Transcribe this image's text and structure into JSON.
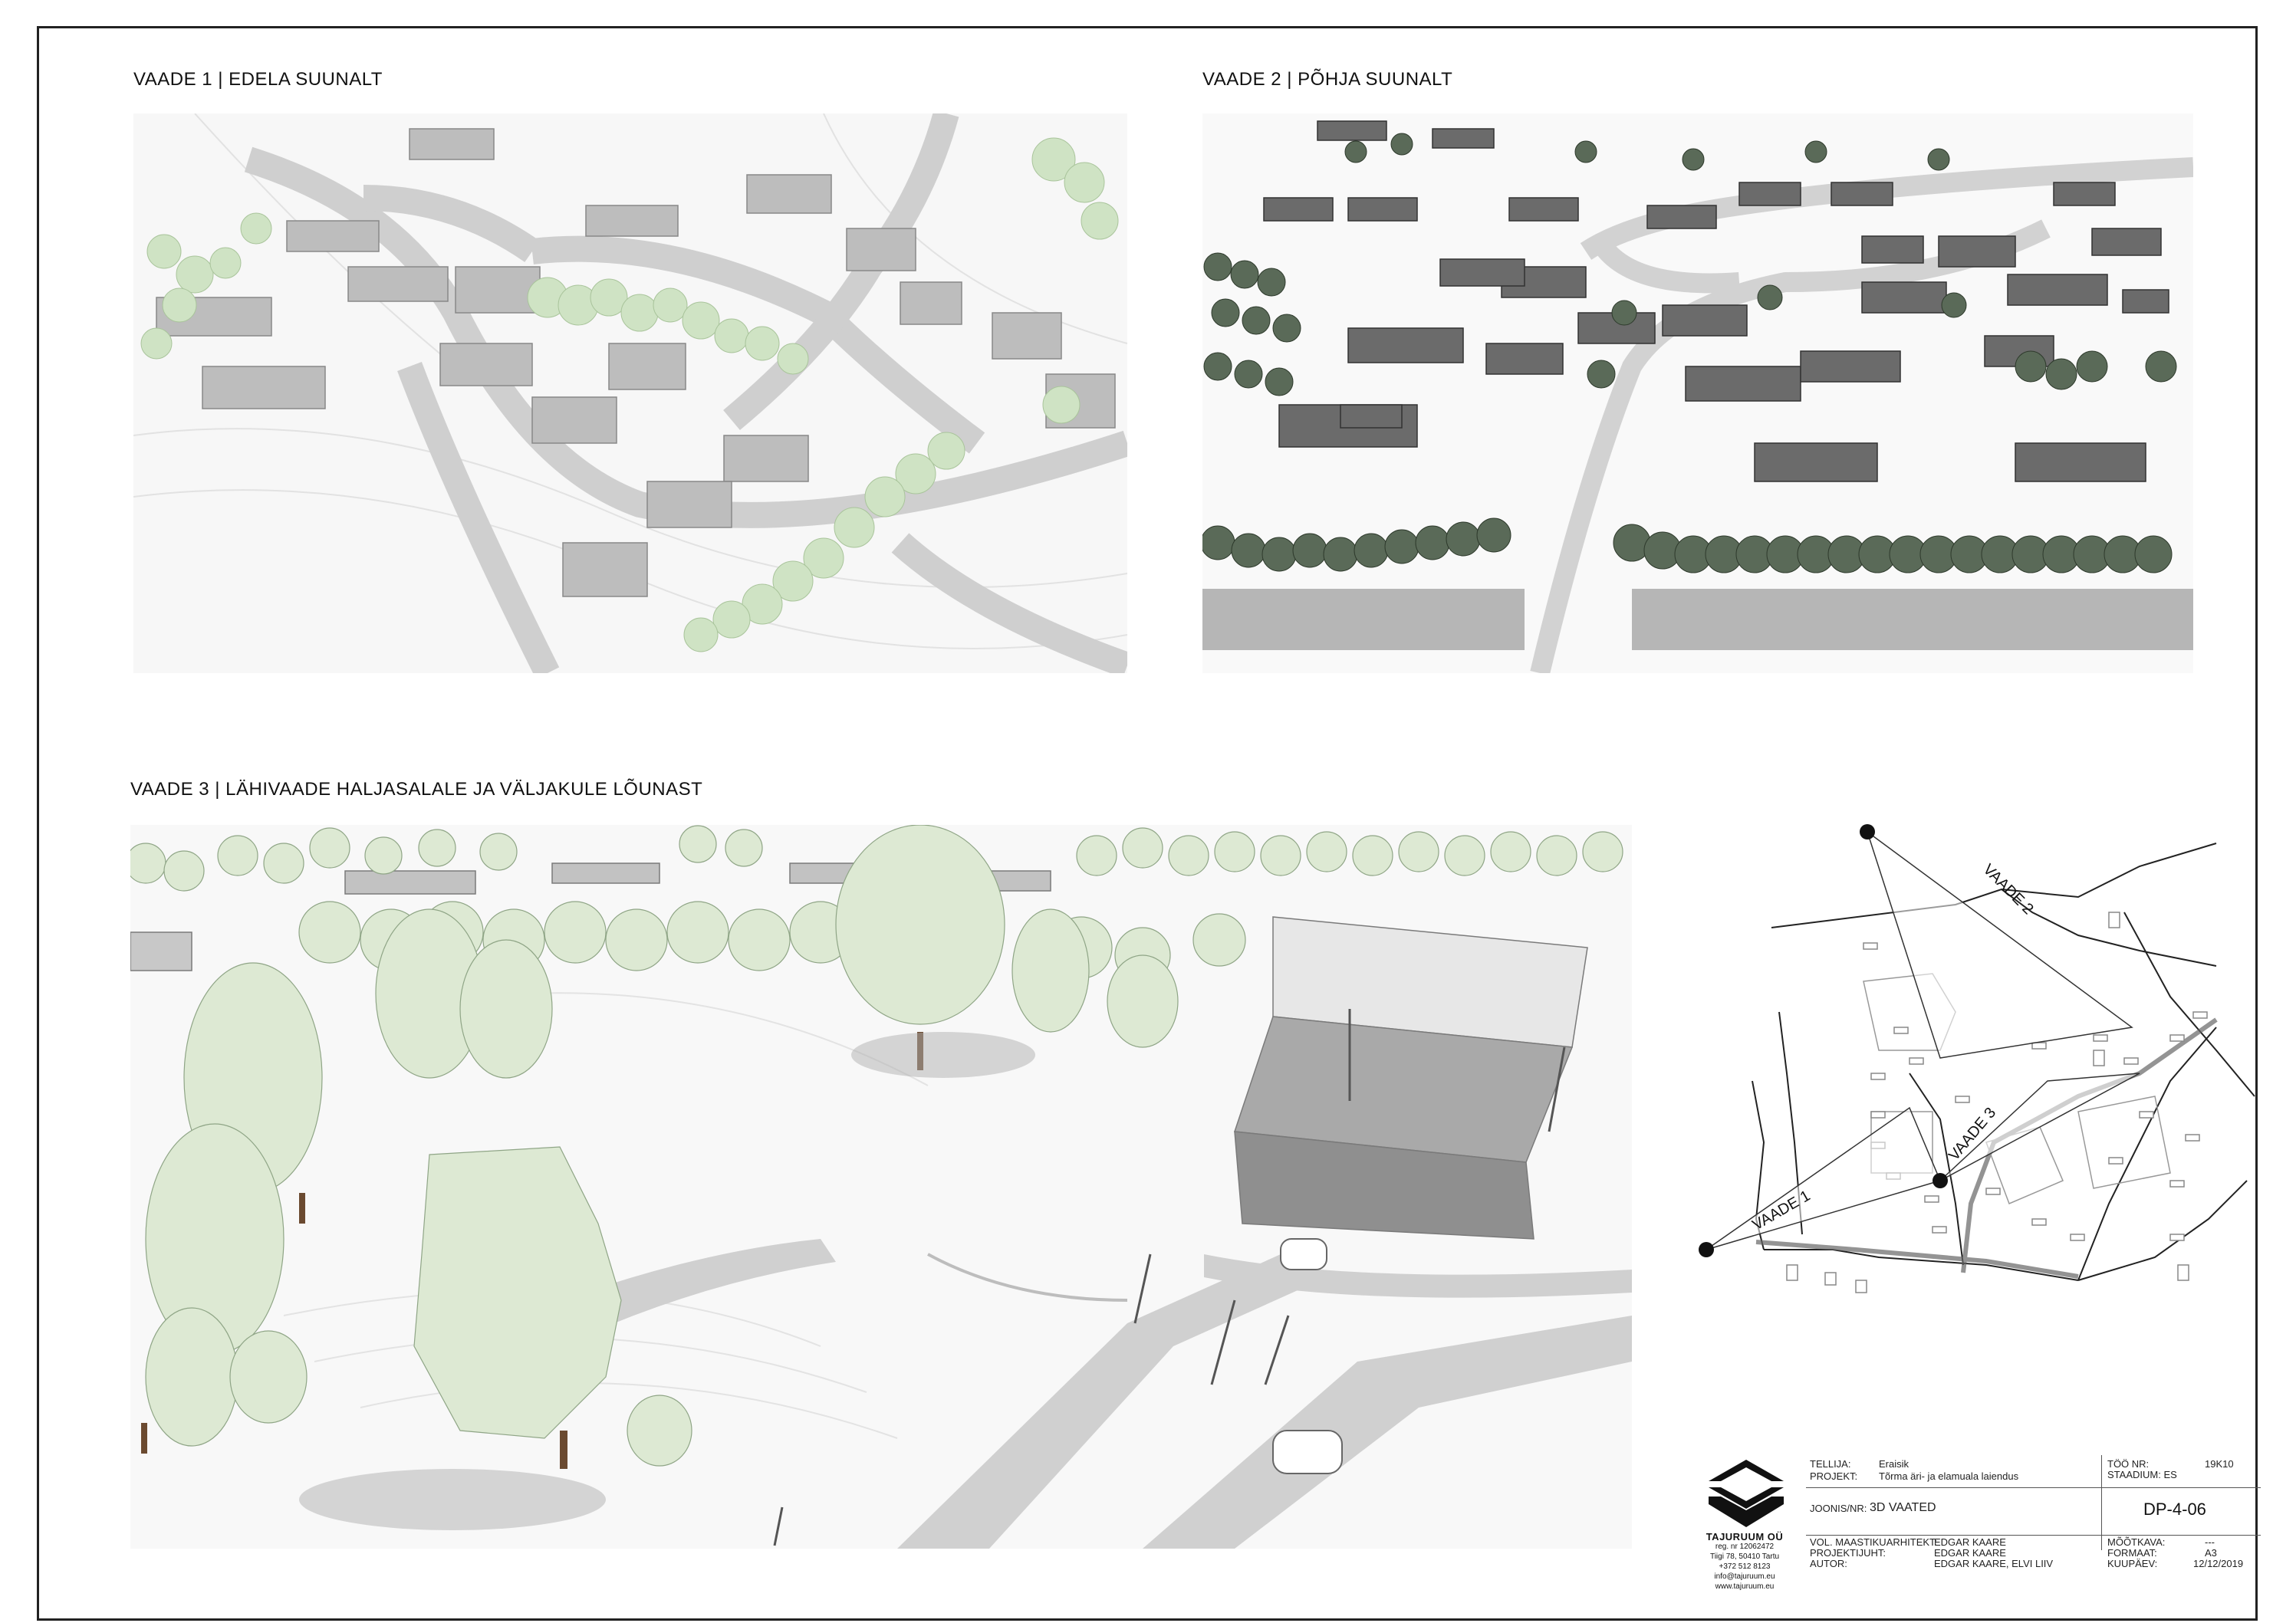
{
  "views": [
    {
      "title": "VAADE 1 | EDELA SUUNALT"
    },
    {
      "title": "VAADE 2 | PÕHJA SUUNALT"
    },
    {
      "title": "VAADE 3 | LÄHIVAADE HALJASALALE JA VÄLJAKULE LÕUNAST"
    }
  ],
  "keymap": {
    "labels": [
      "VAADE 1",
      "VAADE 2",
      "VAADE 3"
    ]
  },
  "company": {
    "name": "TAJURUUM OÜ",
    "reg": "reg. nr 12062472",
    "address": "Tiigi 78, 50410 Tartu",
    "phone": "+372 512 8123",
    "email": "info@tajuruum.eu",
    "web": "www.tajuruum.eu"
  },
  "titleblock": {
    "tellija_label": "TELLIJA:",
    "tellija_value": "Eraisik",
    "projekt_label": "PROJEKT:",
    "projekt_value": "Tõrma äri- ja elamuala laiendus",
    "too_nr_label": "TÖÖ NR:",
    "too_nr_value": "19K10",
    "staadium_label": "STAADIUM:",
    "staadium_value": "ES",
    "joonis_label": "JOONIS/NR:",
    "joonis_value": "3D VAATED",
    "drawing_number": "DP-4-06",
    "vol_label": "VOL. MAASTIKUARHITEKT:",
    "vol_value": "EDGAR KAARE",
    "projektijuht_label": "PROJEKTIJUHT:",
    "projektijuht_value": "EDGAR KAARE",
    "autor_label": "AUTOR:",
    "autor_value": "EDGAR KAARE, ELVI LIIV",
    "mootkava_label": "MÕÕTKAVA:",
    "mootkava_value": "---",
    "formaat_label": "FORMAAT:",
    "formaat_value": "A3",
    "kuupaev_label": "KUUPÄEV:",
    "kuupaev_value": "12/12/2019"
  }
}
